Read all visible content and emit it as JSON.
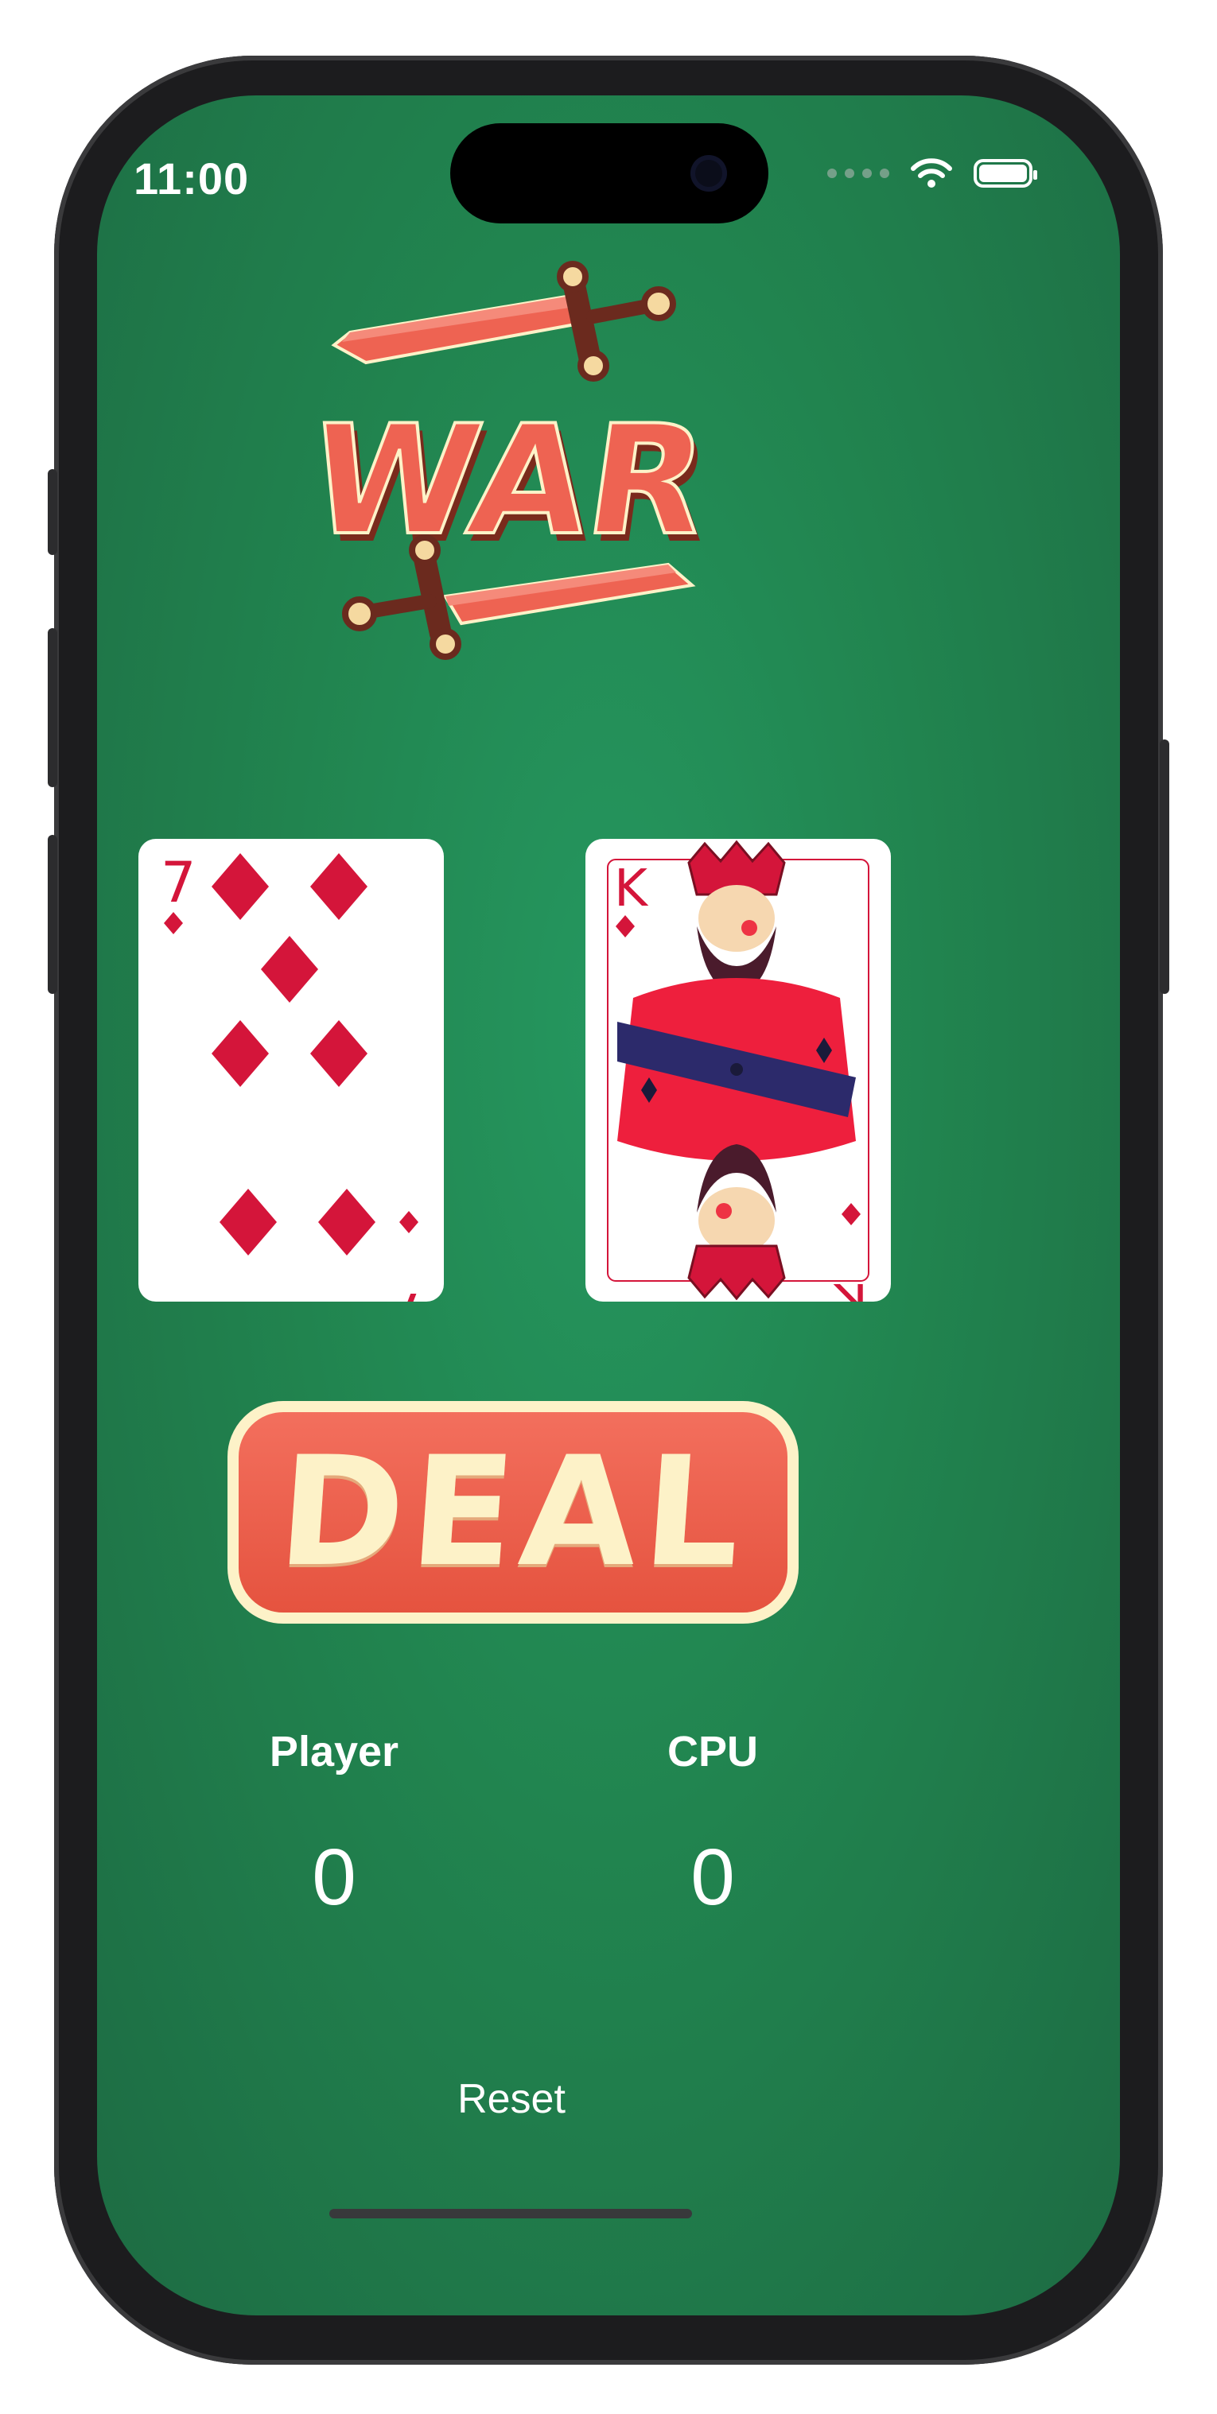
{
  "status_bar": {
    "time": "11:00"
  },
  "logo": {
    "text": "WAR"
  },
  "cards": {
    "player": {
      "rank": "7",
      "suit": "diamonds"
    },
    "cpu": {
      "rank": "K",
      "suit": "diamonds"
    }
  },
  "deal_button": {
    "label": "DEAL"
  },
  "scores": {
    "player": {
      "label": "Player",
      "value": "0"
    },
    "cpu": {
      "label": "CPU",
      "value": "0"
    }
  },
  "reset_button": {
    "label": "Reset"
  },
  "colors": {
    "felt": "#21844f",
    "accent": "#ee6352",
    "cream": "#fdf2c8",
    "suit_red": "#d4153a"
  }
}
